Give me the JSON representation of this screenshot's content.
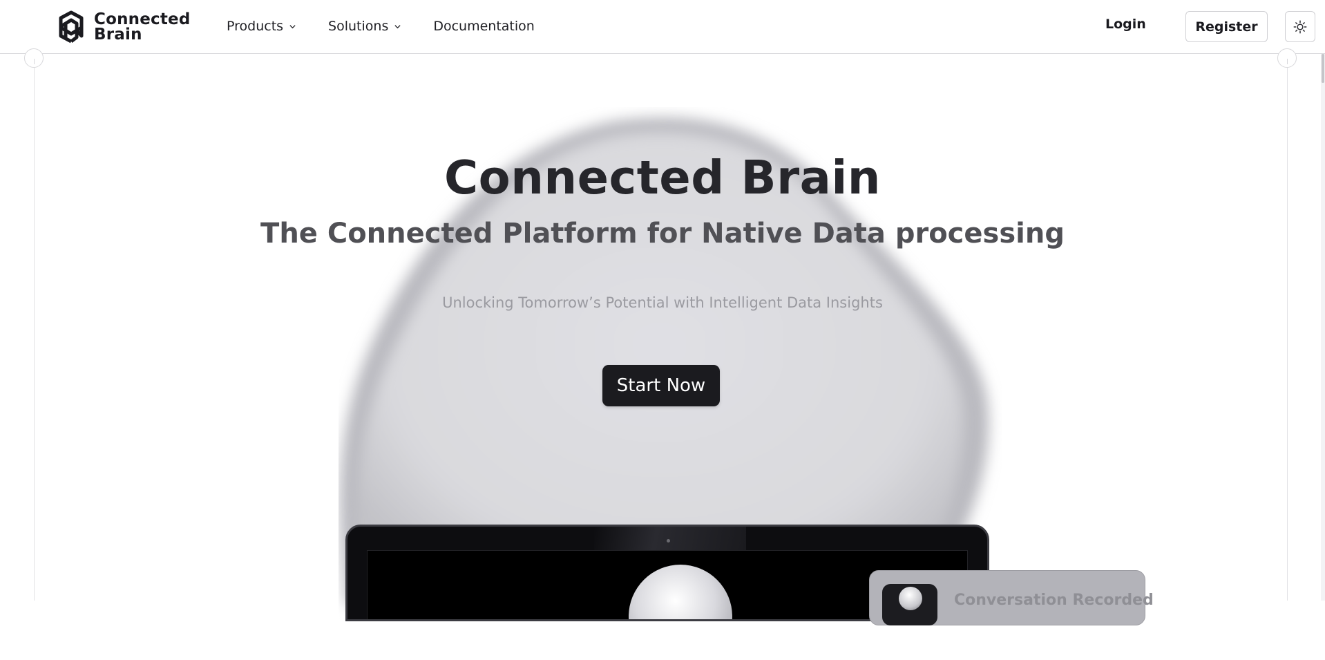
{
  "header": {
    "logo": {
      "line1": "Connected",
      "line2": "Brain",
      "icon": "brain-knot-logo-icon"
    },
    "nav": [
      {
        "label": "Products",
        "has_dropdown": true
      },
      {
        "label": "Solutions",
        "has_dropdown": true
      },
      {
        "label": "Documentation",
        "has_dropdown": false
      }
    ],
    "login_label": "Login",
    "register_label": "Register",
    "theme_toggle_icon": "sun-icon"
  },
  "hero": {
    "title": "Connected Brain",
    "subtitle": "The Connected Platform for Native Data processing",
    "tagline": "Unlocking Tomorrow’s Potential with Intelligent Data Insights",
    "cta_label": "Start Now"
  },
  "preview": {
    "notification_text": "Conversation Recorded"
  },
  "colors": {
    "background": "#ffffff",
    "primary_text": "#26262b",
    "cta_background": "#1b1b1f",
    "blob": "#dcdce0",
    "muted_text": "#9a9aa0"
  }
}
